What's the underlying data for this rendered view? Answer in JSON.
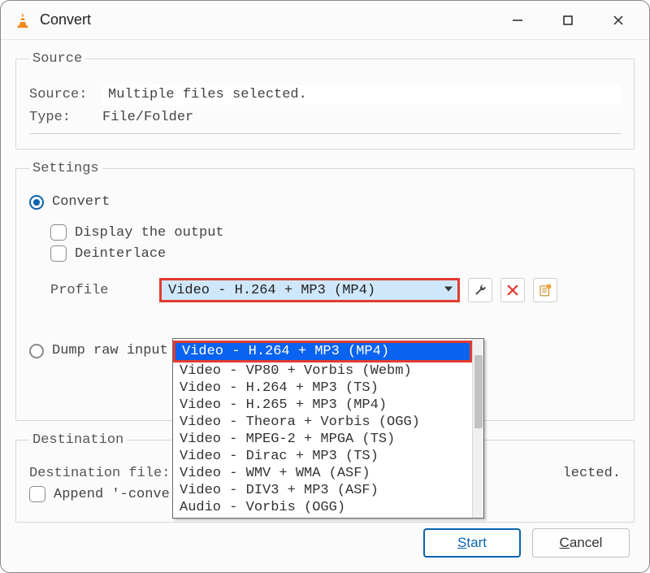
{
  "window": {
    "title": "Convert"
  },
  "source": {
    "legend": "Source",
    "source_label": "Source:",
    "source_value": "Multiple files selected.",
    "type_label": "Type:",
    "type_value": "File/Folder"
  },
  "settings": {
    "legend": "Settings",
    "convert_label": "Convert",
    "display_output_label": "Display the output",
    "deinterlace_label": "Deinterlace",
    "profile_label": "Profile",
    "profile_selected": "Video - H.264 + MP3 (MP4)",
    "profile_options": [
      "Video - H.264 + MP3 (MP4)",
      "Video - VP80 + Vorbis (Webm)",
      "Video - H.264 + MP3 (TS)",
      "Video - H.265 + MP3 (MP4)",
      "Video - Theora + Vorbis (OGG)",
      "Video - MPEG-2 + MPGA (TS)",
      "Video - Dirac + MP3 (TS)",
      "Video - WMV + WMA (ASF)",
      "Video - DIV3 + MP3 (ASF)",
      "Audio - Vorbis (OGG)"
    ],
    "profile_selected_index": 0,
    "tools": {
      "edit_icon": "wrench-icon",
      "delete_icon": "x-red-icon",
      "new_icon": "new-profile-icon"
    },
    "dump_raw_label": "Dump raw input"
  },
  "destination": {
    "legend": "Destination",
    "file_label": "Destination file:",
    "visible_tail": "lected.",
    "append_label": "Append '-conve"
  },
  "footer": {
    "start_prefix": "S",
    "start_rest": "tart",
    "cancel_prefix": "C",
    "cancel_rest": "ancel"
  }
}
